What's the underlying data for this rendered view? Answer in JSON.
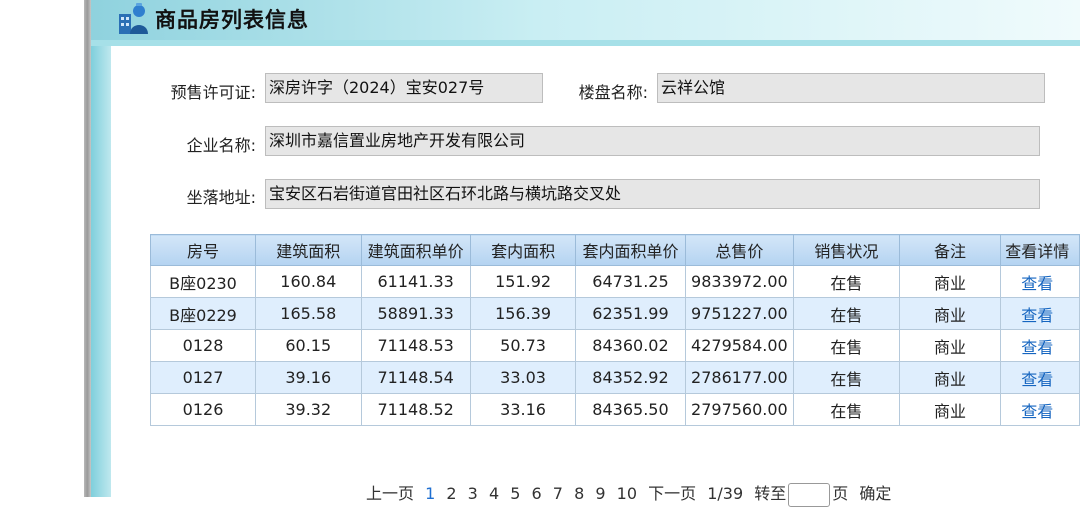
{
  "header": {
    "title": "商品房列表信息",
    "icon": "building-user-icon"
  },
  "info": {
    "presale_label": "预售许可证:",
    "presale_value": "深房许字（2024）宝安027号",
    "project_label": "楼盘名称:",
    "project_value": "云祥公馆",
    "company_label": "企业名称:",
    "company_value": "深圳市嘉信置业房地产开发有限公司",
    "address_label": "坐落地址:",
    "address_value": "宝安区石岩街道官田社区石环北路与横坑路交叉处"
  },
  "table": {
    "headers": [
      "房号",
      "建筑面积",
      "建筑面积单价",
      "套内面积",
      "套内面积单价",
      "总售价",
      "销售状况",
      "备注",
      "查看详情"
    ],
    "rows": [
      [
        "B座0230",
        "160.84",
        "61141.33",
        "151.92",
        "64731.25",
        "9833972.00",
        "在售",
        "商业",
        "查看"
      ],
      [
        "B座0229",
        "165.58",
        "58891.33",
        "156.39",
        "62351.99",
        "9751227.00",
        "在售",
        "商业",
        "查看"
      ],
      [
        "0128",
        "60.15",
        "71148.53",
        "50.73",
        "84360.02",
        "4279584.00",
        "在售",
        "商业",
        "查看"
      ],
      [
        "0127",
        "39.16",
        "71148.54",
        "33.03",
        "84352.92",
        "2786177.00",
        "在售",
        "商业",
        "查看"
      ],
      [
        "0126",
        "39.32",
        "71148.52",
        "33.16",
        "84365.50",
        "2797560.00",
        "在售",
        "商业",
        "查看"
      ]
    ]
  },
  "pager": {
    "prev": "上一页",
    "pages": [
      "1",
      "2",
      "3",
      "4",
      "5",
      "6",
      "7",
      "8",
      "9",
      "10"
    ],
    "current": "1",
    "next": "下一页",
    "total": "1/39",
    "goto_label": "转至",
    "page_unit": "页",
    "confirm": "确定"
  }
}
